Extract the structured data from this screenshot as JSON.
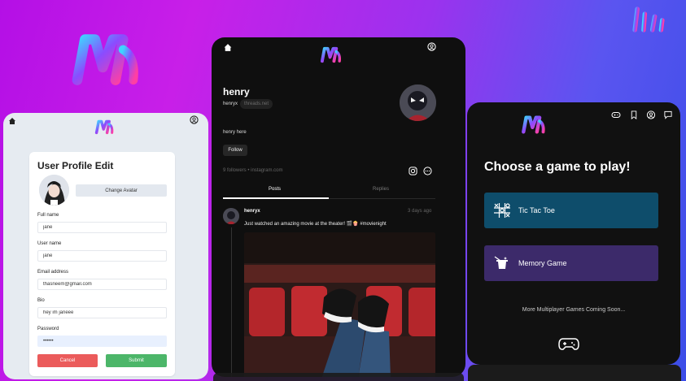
{
  "colors": {
    "accent_purple": "#b40fe6",
    "accent_blue": "#3b4de8",
    "cancel": "#eb5b5b",
    "submit": "#4cb669",
    "tictactoe": "#0e4d6b",
    "memory": "#3c2a6a"
  },
  "profile_edit": {
    "title": "User Profile Edit",
    "change_avatar_label": "Change Avatar",
    "fields": [
      {
        "label": "Full name",
        "value": "jane"
      },
      {
        "label": "User name",
        "value": "jane"
      },
      {
        "label": "Email address",
        "value": "thasneem@gmail.com"
      },
      {
        "label": "Bio",
        "value": "hey im janeee"
      },
      {
        "label": "Password",
        "value": "••••••"
      }
    ],
    "cancel_label": "Cancel",
    "submit_label": "Submit"
  },
  "profile": {
    "name": "henry",
    "handle": "henryx",
    "badge": "threads.net",
    "bio": "henry here",
    "follow_label": "Follow",
    "meta": "9 followers • instagram.com",
    "tabs": [
      "Posts",
      "Replies"
    ],
    "post": {
      "username": "henryx",
      "time": "3 days ago",
      "text": "Just watched an amazing movie at the theater! 🎬🍿 #movienight"
    }
  },
  "games": {
    "title": "Choose a game to play!",
    "items": [
      {
        "label": "Tic Tac Toe"
      },
      {
        "label": "Memory Game"
      }
    ],
    "coming_soon": "More Multiplayer Games Coming Soon..."
  }
}
